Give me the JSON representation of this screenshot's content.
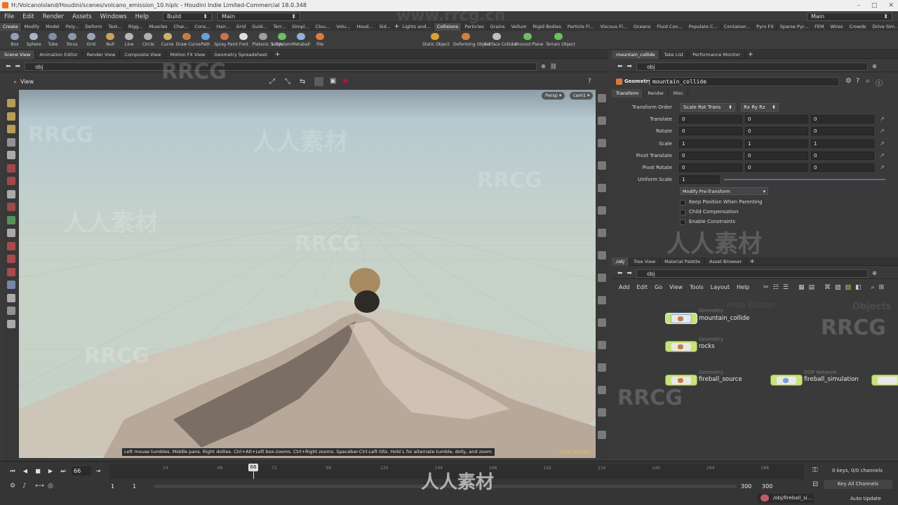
{
  "window": {
    "title": "H:/Volcanolsland/Houdini/scenes/volcano_emission_10.hiplc - Houdini Indie Limited-Commercial 18.0.348",
    "buttons": [
      "–",
      "□",
      "✕"
    ]
  },
  "menubar": {
    "items": [
      "File",
      "Edit",
      "Render",
      "Assets",
      "Windows",
      "Help"
    ],
    "build_label": "Build",
    "desktop_label": "Main",
    "right_desktop_label": "Main"
  },
  "shelf": {
    "left_tabs": [
      "Create",
      "Modify",
      "Model",
      "Poly...",
      "Deform",
      "Text...",
      "Rigg...",
      "Muscles",
      "Char...",
      "Cons...",
      "Hair...",
      "Grid",
      "Guid...",
      "Terr...",
      "Simpl...",
      "Clou...",
      "Volu...",
      "Houd...",
      "Sid..."
    ],
    "right_tabs": [
      "Lights and...",
      "Collisions",
      "Particles",
      "Grains",
      "Vellum",
      "Rigid Bodies",
      "Particle Fl...",
      "Viscous Fl...",
      "Oceans",
      "Fluid Con...",
      "Populate C...",
      "Container...",
      "Pyro FX",
      "Sparse Pyr...",
      "FEM",
      "Wires",
      "Crowds",
      "Drive Sim..."
    ],
    "left_tools": [
      "Box",
      "Sphere",
      "Tube",
      "Torus",
      "Grid",
      "Null",
      "Line",
      "Circle",
      "Curve",
      "Draw Curve",
      "Path",
      "Spray Paint",
      "Font",
      "Platonic Solids",
      "L-System",
      "Metaball",
      "File"
    ],
    "right_tools": [
      "Static Object",
      "Deforming Object",
      "Surface Collider",
      "Ground Plane",
      "Terrain Object"
    ]
  },
  "left_pane": {
    "tabs": [
      "Scene View",
      "Animation Editor",
      "Render View",
      "Composite View",
      "Motion FX View",
      "Geometry Spreadsheet"
    ],
    "path": "obj",
    "view_label": "View",
    "persp_label": "Persp ▾",
    "cam_label": "cam1 ▾",
    "hint": "Left mouse tumbles. Middle pans. Right dollies. Ctrl+Alt+Left box-zooms. Ctrl+Right zooms. Spacebar-Ctrl-Left tilts. Hold L for alternate tumble, dolly, and zoom.",
    "edition": "Indie Edition"
  },
  "param_pane": {
    "tabs": [
      "mountain_collide",
      "Take List",
      "Performance Monitor"
    ],
    "path": "obj",
    "node_type": "Geometry",
    "node_name": "mountain_collide",
    "sub_tabs": [
      "Transform",
      "Render",
      "Misc"
    ],
    "transform_order_label": "Transform Order",
    "transform_order_value": "Scale Rot Trans",
    "rotate_order_value": "Rx Ry Rz",
    "rows": [
      {
        "label": "Translate",
        "values": [
          "0",
          "0",
          "0"
        ]
      },
      {
        "label": "Rotate",
        "values": [
          "0",
          "0",
          "0"
        ]
      },
      {
        "label": "Scale",
        "values": [
          "1",
          "1",
          "1"
        ]
      },
      {
        "label": "Pivot Translate",
        "values": [
          "0",
          "0",
          "0"
        ]
      },
      {
        "label": "Pivot Rotate",
        "values": [
          "0",
          "0",
          "0"
        ]
      }
    ],
    "uniform_scale_label": "Uniform Scale",
    "uniform_scale_value": "1",
    "modify_pre_transform": "Modify Pre-Transform",
    "checkboxes": [
      "Keep Position When Parenting",
      "Child Compensation",
      "Enable Constraints"
    ]
  },
  "network_pane": {
    "tabs": [
      "/obj",
      "Tree View",
      "Material Palette",
      "Asset Browser"
    ],
    "path": "obj",
    "menu": [
      "Add",
      "Edit",
      "Go",
      "View",
      "Tools",
      "Layout",
      "Help"
    ],
    "watermark_edition": "Indie Edition",
    "watermark_context": "Objects",
    "nodes": [
      {
        "type": "Geometry",
        "name": "mountain_collide"
      },
      {
        "type": "Geometry",
        "name": "rocks"
      },
      {
        "type": "Geometry",
        "name": "fireball_source"
      },
      {
        "type": "DOP Network",
        "name": "fireball_simulation"
      }
    ]
  },
  "timeline": {
    "current_frame": "66",
    "ticks": [
      "24",
      "48",
      "72",
      "96",
      "120",
      "144",
      "168",
      "192",
      "216",
      "240",
      "264",
      "288"
    ],
    "start_frame": "1",
    "range_start": "1",
    "range_end": "300",
    "end_frame": "300",
    "keys_label": "0 keys, 0/0 channels",
    "key_all_channels": "Key All Channels",
    "status_path": "/obj/fireball_si...",
    "auto_update": "Auto Update"
  },
  "watermarks": {
    "url": "www.rrcg.cn",
    "brand": "RRCG",
    "cn": "人人素材"
  },
  "colors": {
    "node_green": "#c8e27a",
    "selected_node": "#7fb0f0",
    "edition_yellow": "#f0c030",
    "houdini_orange": "#e8731f"
  }
}
